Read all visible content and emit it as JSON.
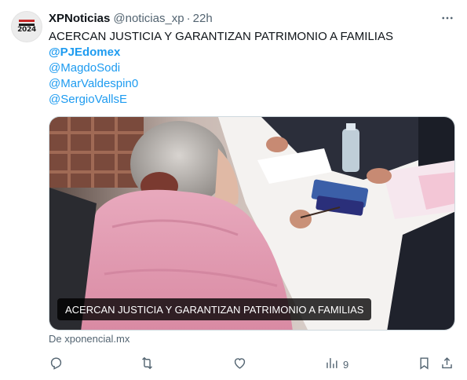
{
  "tweet": {
    "author_name": "XPNoticias",
    "author_handle": "@noticias_xp",
    "separator": "·",
    "time": "22h",
    "avatar_text": "2024",
    "text_lines": [
      "ACERCAN JUSTICIA Y GARANTIZAN PATRIMONIO A FAMILIAS",
      "@PJEdomex",
      "@MagdoSodi",
      "@MarValdespin0",
      "@SergioVallsE"
    ],
    "media_caption": "ACERCAN JUSTICIA Y GARANTIZAN PATRIMONIO A FAMILIAS",
    "source": "De xponencial.mx",
    "views_count": "9"
  },
  "icons": {
    "more": "more-icon",
    "reply": "reply-icon",
    "retweet": "retweet-icon",
    "like": "like-icon",
    "views": "views-icon",
    "bookmark": "bookmark-icon",
    "share": "share-icon"
  },
  "colors": {
    "link": "#1d9bf0",
    "secondary": "#536471",
    "text": "#0f1419"
  }
}
